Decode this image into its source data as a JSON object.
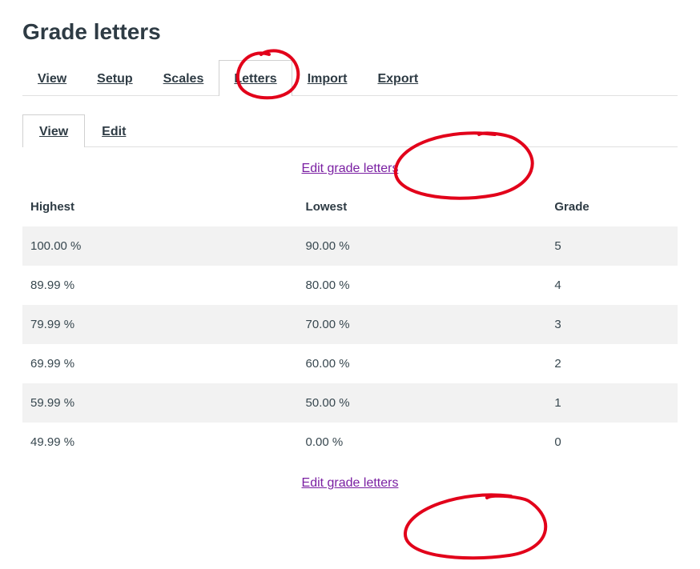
{
  "page_title": "Grade letters",
  "main_tabs": {
    "view": "View",
    "setup": "Setup",
    "scales": "Scales",
    "letters": "Letters",
    "import": "Import",
    "export": "Export"
  },
  "sub_tabs": {
    "view": "View",
    "edit": "Edit"
  },
  "edit_link_top": "Edit grade letters",
  "edit_link_bottom": "Edit grade letters",
  "table": {
    "headers": {
      "highest": "Highest",
      "lowest": "Lowest",
      "grade": "Grade"
    },
    "rows": [
      {
        "highest": "100.00 %",
        "lowest": "90.00 %",
        "grade": "5"
      },
      {
        "highest": "89.99 %",
        "lowest": "80.00 %",
        "grade": "4"
      },
      {
        "highest": "79.99 %",
        "lowest": "70.00 %",
        "grade": "3"
      },
      {
        "highest": "69.99 %",
        "lowest": "60.00 %",
        "grade": "2"
      },
      {
        "highest": "59.99 %",
        "lowest": "50.00 %",
        "grade": "1"
      },
      {
        "highest": "49.99 %",
        "lowest": "0.00 %",
        "grade": "0"
      }
    ]
  }
}
